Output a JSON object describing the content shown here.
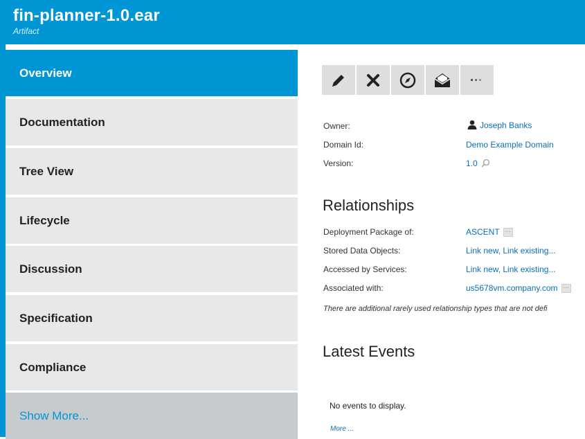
{
  "header": {
    "title": "fin-planner-1.0.ear",
    "subtitle": "Artifact"
  },
  "sidebar": {
    "items": [
      {
        "label": "Overview"
      },
      {
        "label": "Documentation"
      },
      {
        "label": "Tree View"
      },
      {
        "label": "Lifecycle"
      },
      {
        "label": "Discussion"
      },
      {
        "label": "Specification"
      },
      {
        "label": "Compliance"
      }
    ],
    "show_more": "Show More..."
  },
  "toolbar": {
    "buttons": [
      "edit-icon",
      "delete-icon",
      "compass-icon",
      "envelope-icon",
      "more-icon"
    ]
  },
  "details": {
    "owner_label": "Owner:",
    "owner_value": "Joseph Banks",
    "domain_label": "Domain Id:",
    "domain_value": "Demo Example Domain",
    "version_label": "Version:",
    "version_value": "1.0"
  },
  "relationships": {
    "title": "Relationships",
    "rows": [
      {
        "label": "Deployment Package of:",
        "value": "ASCENT"
      },
      {
        "label": "Stored Data Objects:",
        "value": "Link new, Link existing..."
      },
      {
        "label": "Accessed by Services:",
        "value": "Link new, Link existing..."
      },
      {
        "label": "Associated with:",
        "value": "us5678vm.company.com"
      }
    ],
    "note": "There are additional rarely used relationship types that are not defi"
  },
  "events": {
    "title": "Latest Events",
    "empty": "No events to display.",
    "more": "More ..."
  },
  "colors": {
    "accent": "#0096d6",
    "link": "#0a6fb5",
    "nav_bg": "#e6e8e9"
  }
}
